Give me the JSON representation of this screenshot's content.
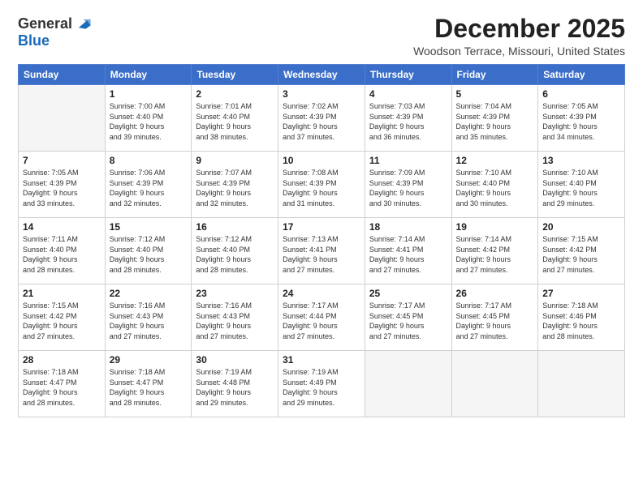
{
  "logo": {
    "general": "General",
    "blue": "Blue"
  },
  "title": {
    "month": "December 2025",
    "location": "Woodson Terrace, Missouri, United States"
  },
  "calendar": {
    "headers": [
      "Sunday",
      "Monday",
      "Tuesday",
      "Wednesday",
      "Thursday",
      "Friday",
      "Saturday"
    ],
    "rows": [
      [
        {
          "num": "",
          "info": ""
        },
        {
          "num": "1",
          "info": "Sunrise: 7:00 AM\nSunset: 4:40 PM\nDaylight: 9 hours\nand 39 minutes."
        },
        {
          "num": "2",
          "info": "Sunrise: 7:01 AM\nSunset: 4:40 PM\nDaylight: 9 hours\nand 38 minutes."
        },
        {
          "num": "3",
          "info": "Sunrise: 7:02 AM\nSunset: 4:39 PM\nDaylight: 9 hours\nand 37 minutes."
        },
        {
          "num": "4",
          "info": "Sunrise: 7:03 AM\nSunset: 4:39 PM\nDaylight: 9 hours\nand 36 minutes."
        },
        {
          "num": "5",
          "info": "Sunrise: 7:04 AM\nSunset: 4:39 PM\nDaylight: 9 hours\nand 35 minutes."
        },
        {
          "num": "6",
          "info": "Sunrise: 7:05 AM\nSunset: 4:39 PM\nDaylight: 9 hours\nand 34 minutes."
        }
      ],
      [
        {
          "num": "7",
          "info": "Sunrise: 7:05 AM\nSunset: 4:39 PM\nDaylight: 9 hours\nand 33 minutes."
        },
        {
          "num": "8",
          "info": "Sunrise: 7:06 AM\nSunset: 4:39 PM\nDaylight: 9 hours\nand 32 minutes."
        },
        {
          "num": "9",
          "info": "Sunrise: 7:07 AM\nSunset: 4:39 PM\nDaylight: 9 hours\nand 32 minutes."
        },
        {
          "num": "10",
          "info": "Sunrise: 7:08 AM\nSunset: 4:39 PM\nDaylight: 9 hours\nand 31 minutes."
        },
        {
          "num": "11",
          "info": "Sunrise: 7:09 AM\nSunset: 4:39 PM\nDaylight: 9 hours\nand 30 minutes."
        },
        {
          "num": "12",
          "info": "Sunrise: 7:10 AM\nSunset: 4:40 PM\nDaylight: 9 hours\nand 30 minutes."
        },
        {
          "num": "13",
          "info": "Sunrise: 7:10 AM\nSunset: 4:40 PM\nDaylight: 9 hours\nand 29 minutes."
        }
      ],
      [
        {
          "num": "14",
          "info": "Sunrise: 7:11 AM\nSunset: 4:40 PM\nDaylight: 9 hours\nand 28 minutes."
        },
        {
          "num": "15",
          "info": "Sunrise: 7:12 AM\nSunset: 4:40 PM\nDaylight: 9 hours\nand 28 minutes."
        },
        {
          "num": "16",
          "info": "Sunrise: 7:12 AM\nSunset: 4:40 PM\nDaylight: 9 hours\nand 28 minutes."
        },
        {
          "num": "17",
          "info": "Sunrise: 7:13 AM\nSunset: 4:41 PM\nDaylight: 9 hours\nand 27 minutes."
        },
        {
          "num": "18",
          "info": "Sunrise: 7:14 AM\nSunset: 4:41 PM\nDaylight: 9 hours\nand 27 minutes."
        },
        {
          "num": "19",
          "info": "Sunrise: 7:14 AM\nSunset: 4:42 PM\nDaylight: 9 hours\nand 27 minutes."
        },
        {
          "num": "20",
          "info": "Sunrise: 7:15 AM\nSunset: 4:42 PM\nDaylight: 9 hours\nand 27 minutes."
        }
      ],
      [
        {
          "num": "21",
          "info": "Sunrise: 7:15 AM\nSunset: 4:42 PM\nDaylight: 9 hours\nand 27 minutes."
        },
        {
          "num": "22",
          "info": "Sunrise: 7:16 AM\nSunset: 4:43 PM\nDaylight: 9 hours\nand 27 minutes."
        },
        {
          "num": "23",
          "info": "Sunrise: 7:16 AM\nSunset: 4:43 PM\nDaylight: 9 hours\nand 27 minutes."
        },
        {
          "num": "24",
          "info": "Sunrise: 7:17 AM\nSunset: 4:44 PM\nDaylight: 9 hours\nand 27 minutes."
        },
        {
          "num": "25",
          "info": "Sunrise: 7:17 AM\nSunset: 4:45 PM\nDaylight: 9 hours\nand 27 minutes."
        },
        {
          "num": "26",
          "info": "Sunrise: 7:17 AM\nSunset: 4:45 PM\nDaylight: 9 hours\nand 27 minutes."
        },
        {
          "num": "27",
          "info": "Sunrise: 7:18 AM\nSunset: 4:46 PM\nDaylight: 9 hours\nand 28 minutes."
        }
      ],
      [
        {
          "num": "28",
          "info": "Sunrise: 7:18 AM\nSunset: 4:47 PM\nDaylight: 9 hours\nand 28 minutes."
        },
        {
          "num": "29",
          "info": "Sunrise: 7:18 AM\nSunset: 4:47 PM\nDaylight: 9 hours\nand 28 minutes."
        },
        {
          "num": "30",
          "info": "Sunrise: 7:19 AM\nSunset: 4:48 PM\nDaylight: 9 hours\nand 29 minutes."
        },
        {
          "num": "31",
          "info": "Sunrise: 7:19 AM\nSunset: 4:49 PM\nDaylight: 9 hours\nand 29 minutes."
        },
        {
          "num": "",
          "info": ""
        },
        {
          "num": "",
          "info": ""
        },
        {
          "num": "",
          "info": ""
        }
      ]
    ]
  }
}
